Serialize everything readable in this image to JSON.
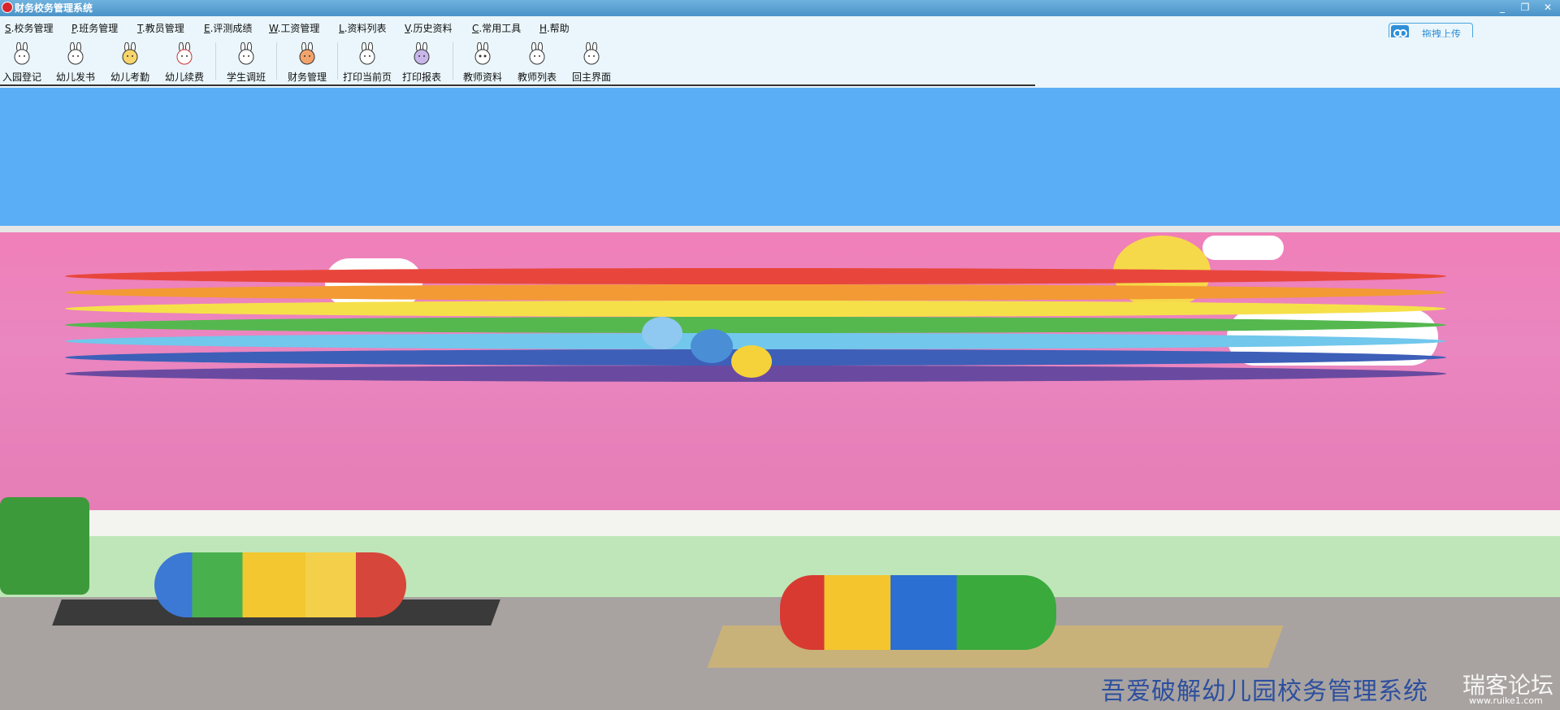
{
  "window": {
    "title": "财务校务管理系统",
    "controls": [
      "_",
      "❐",
      "✕"
    ]
  },
  "menu": [
    {
      "key": "S",
      "label": ".校务管理"
    },
    {
      "key": "P",
      "label": ".班务管理"
    },
    {
      "key": "T",
      "label": ".教员管理"
    },
    {
      "key": "E",
      "label": ".评测成绩"
    },
    {
      "key": "W",
      "label": ".工资管理"
    },
    {
      "key": "L",
      "label": ".资料列表"
    },
    {
      "key": "V",
      "label": ".历史资料"
    },
    {
      "key": "C",
      "label": ".常用工具"
    },
    {
      "key": "H",
      "label": ".帮助"
    }
  ],
  "upload": {
    "label": "拖拽上传",
    "icon": "cloud-upload-icon"
  },
  "toolbar": [
    {
      "label": "入园登记",
      "icon": "rabbit-icon"
    },
    {
      "label": "幼儿发书",
      "icon": "rabbit-icon"
    },
    {
      "label": "幼儿考勤",
      "icon": "rabbit-icon"
    },
    {
      "label": "幼儿续费",
      "icon": "rabbit-icon"
    },
    {
      "label": "学生调班",
      "icon": "rabbit-icon"
    },
    {
      "label": "财务管理",
      "icon": "rabbit-icon"
    },
    {
      "label": "打印当前页",
      "icon": "rabbit-icon"
    },
    {
      "label": "打印报表",
      "icon": "rabbit-icon"
    },
    {
      "label": "教师资料",
      "icon": "rabbit-icon"
    },
    {
      "label": "教师列表",
      "icon": "rabbit-icon"
    },
    {
      "label": "回主界面",
      "icon": "rabbit-icon"
    }
  ],
  "background": {
    "watermark_text": "吾爱破解幼儿园校务管理系统",
    "forum_mark": "瑞客论坛",
    "forum_url": "www.ruike1.com"
  },
  "colors": {
    "sky": "#5aaef5",
    "menubar": "#eaf6fb",
    "titlebar": "#4a93c8"
  }
}
